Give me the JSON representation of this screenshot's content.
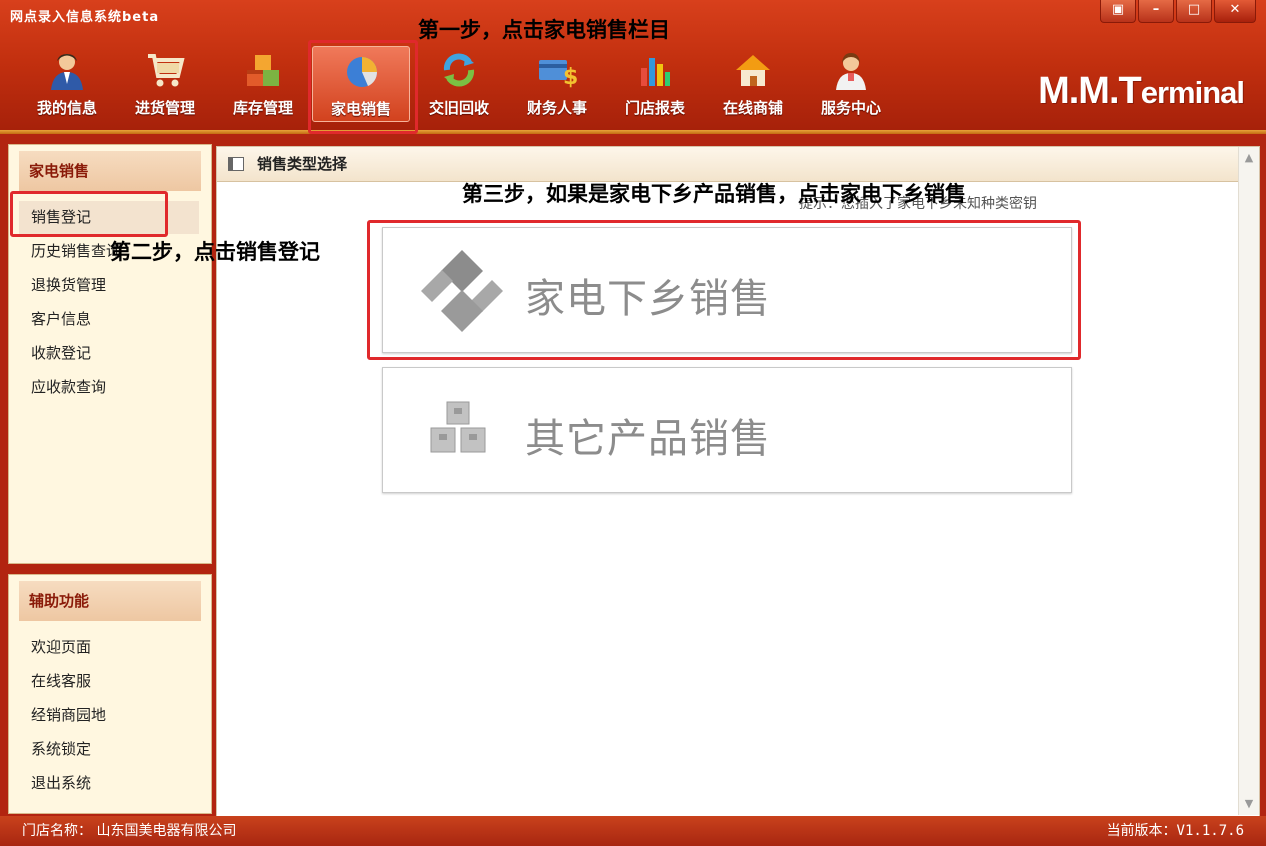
{
  "window": {
    "title": "网点录入信息系统beta",
    "buttons": [
      "▣",
      "–",
      "□",
      "✕"
    ]
  },
  "brand": {
    "main": "M.M.T",
    "rest": "erminal"
  },
  "nav": [
    {
      "label": "我的信息",
      "icon": "user-icon"
    },
    {
      "label": "进货管理",
      "icon": "cart-icon"
    },
    {
      "label": "库存管理",
      "icon": "boxes-icon"
    },
    {
      "label": "家电销售",
      "icon": "pie-chart-icon",
      "active": true
    },
    {
      "label": "交旧回收",
      "icon": "recycle-icon"
    },
    {
      "label": "财务人事",
      "icon": "money-icon"
    },
    {
      "label": "门店报表",
      "icon": "bar-chart-icon"
    },
    {
      "label": "在线商铺",
      "icon": "house-icon"
    },
    {
      "label": "服务中心",
      "icon": "service-person-icon"
    }
  ],
  "annotations": {
    "step1": "第一步，点击家电销售栏目",
    "step2": "第二步，点击销售登记",
    "step3": "第三步，如果是家电下乡产品销售，点击家电下乡销售"
  },
  "sidebar": {
    "section1": {
      "title": "家电销售",
      "items": [
        "销售登记",
        "历史销售查询",
        "退换货管理",
        "客户信息",
        "收款登记",
        "应收款查询"
      ]
    },
    "section2": {
      "title": "辅助功能",
      "items": [
        "欢迎页面",
        "在线客服",
        "经销商园地",
        "系统锁定",
        "退出系统"
      ]
    }
  },
  "content": {
    "title": "销售类型选择",
    "hint": "提示：您插入了家电下乡未知种类密钥",
    "options": [
      {
        "label": "家电下乡销售",
        "icon": "rural-appliance-logo-icon"
      },
      {
        "label": "其它产品销售",
        "icon": "stacked-boxes-icon"
      }
    ]
  },
  "status": {
    "store": "门店名称： 山东国美电器有限公司",
    "version": "当前版本：V1.1.7.6"
  },
  "colors": {
    "header": "#c3300f",
    "annotation_box": "#e0292c",
    "panel_bg": "#fff7e0"
  }
}
